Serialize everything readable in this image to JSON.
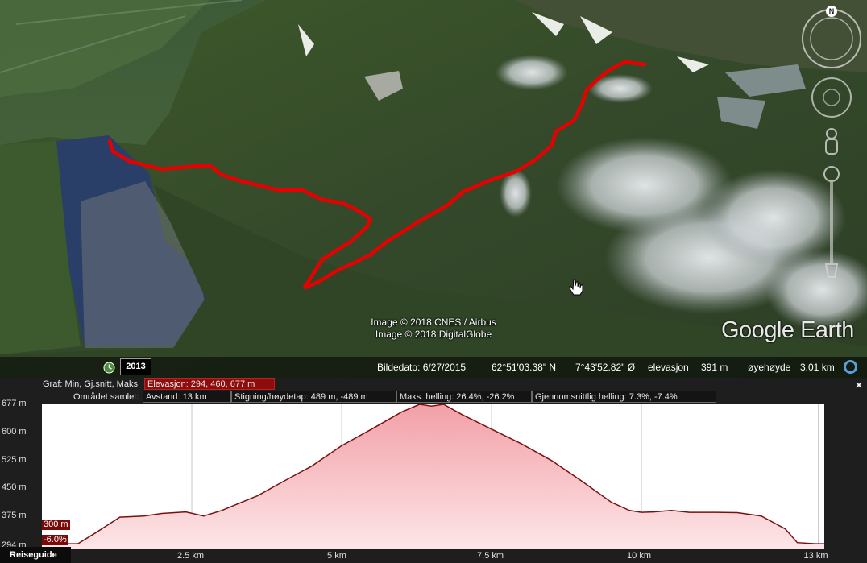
{
  "map": {
    "credits": [
      "Image © 2018 CNES / Airbus",
      "Image © 2018 DigitalGlobe"
    ],
    "logo": "Google Earth",
    "compass_label": "N",
    "historic_year": "2013",
    "status": {
      "image_date": "Bildedato: 6/27/2015",
      "latitude": "62°51'03.38\" N",
      "longitude": "7°43'52.82\" Ø",
      "elevation_label": "elevasjon",
      "elevation_value": "391 m",
      "eye_alt_label": "øyehøyde",
      "eye_alt_value": "3.01 km"
    },
    "icons": [
      "compass-icon",
      "look-joystick-icon",
      "move-joystick-icon",
      "street-view-pegman-icon",
      "zoom-slider-icon",
      "historic-imagery-icon",
      "globe-icon",
      "hand-cursor-icon"
    ]
  },
  "panel": {
    "graph_label": "Graf: Min, Gj.snitt, Maks",
    "elevation_stat": "Elevasjon: 294, 460, 677 m",
    "area_label": "Området samlet:",
    "distance": "Avstand: 13 km",
    "climb": "Stigning/høydetap: 489 m, -489 m",
    "max_slope": "Maks. helling: 26.4%, -26.2%",
    "avg_slope": "Gjennomsnittlig helling: 7.3%, -7.4%",
    "close": "×",
    "cursor_elev": "300 m",
    "cursor_slope": "-6.0%",
    "reiseguide": "Reiseguide"
  },
  "colors": {
    "track": "#e60000",
    "profile_fill_top": "#f3a6ac",
    "profile_line": "#7a1010"
  },
  "chart_data": {
    "type": "area",
    "xlabel": "",
    "ylabel": "",
    "x_ticks": [
      "2.5 km",
      "5 km",
      "7.5 km",
      "10 km",
      "13 km"
    ],
    "x_tick_values": [
      2.5,
      5,
      7.5,
      10,
      12.95
    ],
    "y_ticks": [
      "677 m",
      "600 m",
      "525 m",
      "450 m",
      "375 m",
      "294 m"
    ],
    "y_tick_values": [
      677,
      600,
      525,
      450,
      375,
      294
    ],
    "xlim": [
      0,
      13.05
    ],
    "ylim": [
      285,
      677
    ],
    "x": [
      0,
      0.6,
      0.9,
      1.3,
      1.7,
      2.0,
      2.4,
      2.7,
      3.0,
      3.3,
      3.6,
      4.0,
      4.5,
      5.0,
      5.5,
      6.0,
      6.3,
      6.5,
      6.7,
      7.0,
      7.5,
      8.0,
      8.5,
      9.0,
      9.5,
      9.8,
      10.0,
      10.2,
      10.5,
      10.8,
      11.2,
      11.6,
      12.0,
      12.4,
      12.6,
      12.9,
      13.05
    ],
    "y": [
      300,
      300,
      330,
      372,
      375,
      382,
      386,
      375,
      390,
      410,
      430,
      466,
      510,
      565,
      610,
      656,
      677,
      672,
      677,
      650,
      610,
      570,
      525,
      470,
      412,
      390,
      385,
      386,
      390,
      385,
      385,
      384,
      375,
      340,
      303,
      300,
      300
    ]
  }
}
